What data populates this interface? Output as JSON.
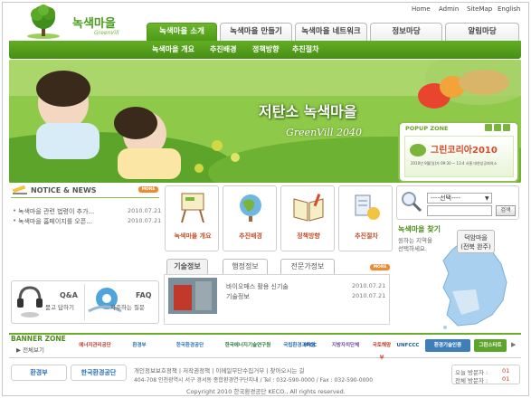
{
  "site": {
    "title": "녹색마을",
    "subtitle": "GreenVill"
  },
  "utility_nav": [
    "Home",
    "Admin",
    "SiteMap",
    "English"
  ],
  "main_tabs": [
    {
      "label": "녹색마을 소개",
      "active": true
    },
    {
      "label": "녹색마을 만들기",
      "active": false
    },
    {
      "label": "녹색마을 네트워크",
      "active": false
    },
    {
      "label": "정보마당",
      "active": false
    },
    {
      "label": "알림마당",
      "active": false
    }
  ],
  "sub_nav": [
    "녹색마을 개요",
    "추진배경",
    "정책방향",
    "추진절차"
  ],
  "hero": {
    "title": "저탄소 녹색마을",
    "subtitle": "GreenVill 2040"
  },
  "popup_zone": {
    "label": "POPUP ZONE",
    "banner_title": "그린코리아2010",
    "banner_detail": "2010년 9월[일]자 09:30 ~ 13:4 서울 대한상공회의소"
  },
  "notice": {
    "title": "NOTICE & NEWS",
    "more": "MORE",
    "items": [
      {
        "text": "녹색마을 관련 법령이 추가...",
        "date": "2010.07.21"
      },
      {
        "text": "녹색마을 홈페이지를 오픈...",
        "date": "2010.07.21"
      }
    ]
  },
  "quick_cards": [
    {
      "label": "녹색마을 개요",
      "icon": "easel-icon"
    },
    {
      "label": "추진배경",
      "icon": "globe-icon"
    },
    {
      "label": "정책방향",
      "icon": "book-icon"
    },
    {
      "label": "추진절차",
      "icon": "steps-icon"
    }
  ],
  "search": {
    "select_label": "----선택----",
    "button": "검색"
  },
  "map": {
    "title": "녹색마을 찾기",
    "desc_line1": "원하는 지역을",
    "desc_line2": "선택하세요.",
    "popup_line1": "덕암마을",
    "popup_line2": "(전북 완주)"
  },
  "info_tabs": {
    "tabs": [
      "기술정보",
      "행정정보",
      "전문가정보"
    ],
    "more": "MORE",
    "items": [
      {
        "text": "바이오매스 활용 신기술",
        "date": "2010.07.21"
      },
      {
        "text": "기술정보",
        "date": "2010.07.21"
      }
    ]
  },
  "qa": {
    "qa_title": "Q&A",
    "qa_sub": "묻고 답하기",
    "faq_title": "FAQ",
    "faq_sub": "자주하는 질문"
  },
  "banner_zone": {
    "title": "BANNER ZONE",
    "sub": "▶ 전체보기",
    "logos": [
      "에너지관리공단",
      "환경부",
      "한국환경공단",
      "한국에너지기술연구원",
      "국립환경과학원",
      "IPCC",
      "지방자치단체",
      "국토해양부",
      "UNFCCC",
      "환경기술인증",
      "그린스타트"
    ]
  },
  "footer": {
    "logo1": "환경부",
    "logo2": "한국환경공단",
    "links": "개인정보보호정책  |  저작권정책  |  이메일무단수집거부  |  찾아오시는 길",
    "address": "404-708 인천광역시 서구 경서동 종합환경연구단지내 / Tel : 032-590-0000 / Fax : 032-590-0000",
    "copyright": "Copyright 2010 한국환경공단 KECO., All rights reserved.",
    "today_label": "오늘 방문자 :",
    "today_value": "01",
    "total_label": "전체 방문자 :",
    "total_value": "01"
  },
  "colors": {
    "brand_green": "#4d9a18",
    "accent_orange": "#f08a30"
  }
}
